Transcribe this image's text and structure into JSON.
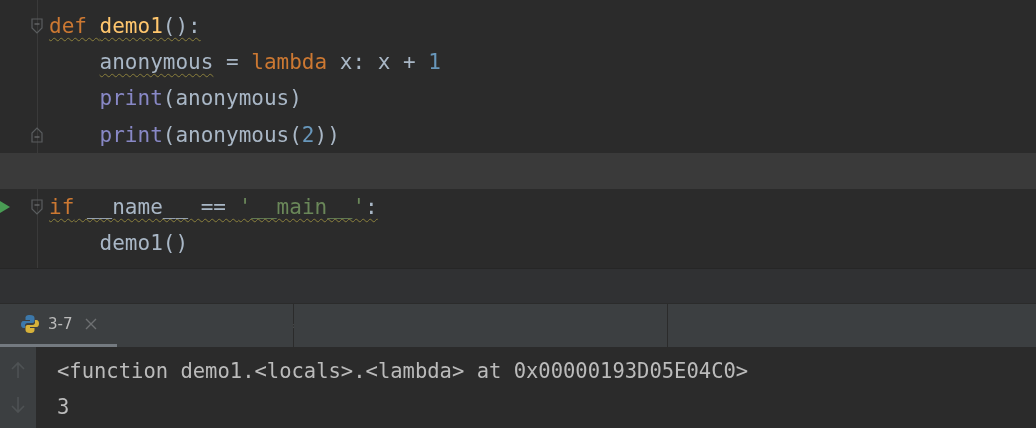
{
  "editor": {
    "lines": [
      {
        "fold_open": true,
        "fold_close": false,
        "run": false,
        "current": false,
        "indent": false,
        "tokens": [
          {
            "text": "def ",
            "kind": "keyword",
            "underlined": true
          },
          {
            "text": "demo1",
            "kind": "function",
            "underlined": true
          },
          {
            "text": "():",
            "kind": "plain",
            "underlined": true
          }
        ]
      },
      {
        "fold_open": false,
        "fold_close": false,
        "run": false,
        "current": false,
        "indent": true,
        "tokens": [
          {
            "text": "anonymous",
            "kind": "plain",
            "underlined": true
          },
          {
            "text": " = ",
            "kind": "plain",
            "underlined": false
          },
          {
            "text": "lambda",
            "kind": "keyword",
            "underlined": false
          },
          {
            "text": " x: x + ",
            "kind": "plain",
            "underlined": false
          },
          {
            "text": "1",
            "kind": "number",
            "underlined": false
          }
        ]
      },
      {
        "fold_open": false,
        "fold_close": false,
        "run": false,
        "current": false,
        "indent": true,
        "tokens": [
          {
            "text": "print",
            "kind": "builtin",
            "underlined": false
          },
          {
            "text": "(anonymous)",
            "kind": "plain",
            "underlined": false
          }
        ]
      },
      {
        "fold_open": false,
        "fold_close": true,
        "run": false,
        "current": false,
        "indent": true,
        "tokens": [
          {
            "text": "print",
            "kind": "builtin",
            "underlined": false
          },
          {
            "text": "(anonymous(",
            "kind": "plain",
            "underlined": false
          },
          {
            "text": "2",
            "kind": "number",
            "underlined": false
          },
          {
            "text": "))",
            "kind": "plain",
            "underlined": false
          }
        ]
      },
      {
        "fold_open": false,
        "fold_close": false,
        "run": false,
        "current": true
      },
      {
        "fold_open": true,
        "fold_close": false,
        "run": true,
        "current": false,
        "indent": false,
        "tokens": [
          {
            "text": "if",
            "kind": "keyword",
            "underlined": true
          },
          {
            "text": " __name__ == ",
            "kind": "plain",
            "underlined": true
          },
          {
            "text": "'__main__'",
            "kind": "string",
            "underlined": true
          },
          {
            "text": ":",
            "kind": "plain",
            "underlined": true
          }
        ]
      },
      {
        "fold_open": false,
        "fold_close": false,
        "run": false,
        "current": false,
        "indent": true,
        "tokens": [
          {
            "text": "demo1()",
            "kind": "plain",
            "underlined": false
          }
        ]
      }
    ]
  },
  "run_panel": {
    "tabs": [
      {
        "label": "3-7",
        "selected": true
      }
    ],
    "output": [
      "<function demo1.<locals>.<lambda> at 0x00000193D05E04C0>",
      "3"
    ]
  }
}
